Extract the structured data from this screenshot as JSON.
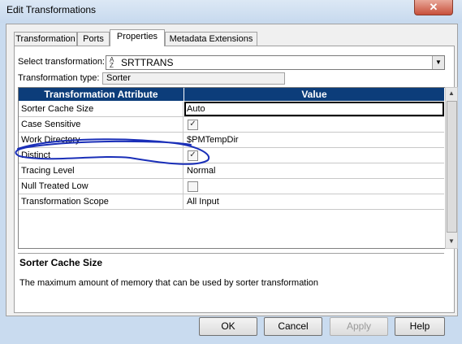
{
  "window": {
    "title": "Edit Transformations",
    "close_glyph": "✕"
  },
  "tabs": [
    {
      "label": "Transformation",
      "active": false
    },
    {
      "label": "Ports",
      "active": false
    },
    {
      "label": "Properties",
      "active": true
    },
    {
      "label": "Metadata Extensions",
      "active": false
    }
  ],
  "select_transformation": {
    "label": "Select transformation:",
    "value": "SRTTRANS",
    "icon": "sorter-az-icon"
  },
  "transformation_type": {
    "label": "Transformation type:",
    "value": "Sorter"
  },
  "grid": {
    "headers": [
      "Transformation Attribute",
      "Value"
    ],
    "rows": [
      {
        "attribute": "Sorter Cache Size",
        "value": "Auto",
        "type": "text"
      },
      {
        "attribute": "Case Sensitive",
        "value": "",
        "type": "checkbox",
        "checked": true
      },
      {
        "attribute": "Work Directory",
        "value": "$PMTempDir",
        "type": "text"
      },
      {
        "attribute": "Distinct",
        "value": "",
        "type": "checkbox",
        "checked": true
      },
      {
        "attribute": "Tracing Level",
        "value": "Normal",
        "type": "text"
      },
      {
        "attribute": "Null Treated Low",
        "value": "",
        "type": "checkbox",
        "checked": false
      },
      {
        "attribute": "Transformation Scope",
        "value": "All Input",
        "type": "text"
      }
    ]
  },
  "description": {
    "title": "Sorter Cache Size",
    "text": "The maximum amount of memory that can be used by sorter transformation"
  },
  "buttons": {
    "ok": "OK",
    "cancel": "Cancel",
    "apply": "Apply",
    "help": "Help"
  },
  "colors": {
    "header_bg": "#0c3d7a",
    "annotation_ink": "#1a2fb8"
  }
}
